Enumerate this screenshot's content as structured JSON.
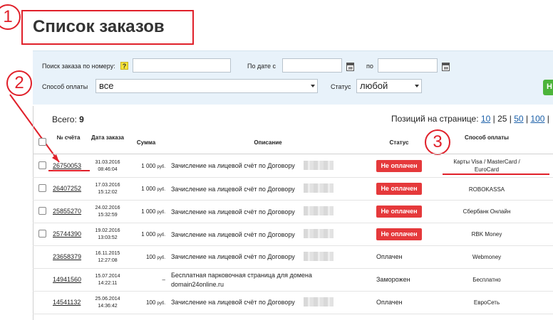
{
  "page": {
    "title": "Список заказов"
  },
  "callouts": {
    "one": "1",
    "two": "2",
    "three": "3"
  },
  "filters": {
    "search_label": "Поиск заказа по номеру:",
    "help": "?",
    "search_value": "",
    "date_from_label": "По дате с",
    "date_from_value": "",
    "date_to_label": "по",
    "date_to_value": "",
    "payment_label": "Способ оплаты",
    "payment_value": "все",
    "status_label": "Статус",
    "status_value": "любой",
    "apply_label": "Н"
  },
  "summary": {
    "total_label": "Всего:",
    "total_value": "9",
    "perpage_label": "Позиций на странице:",
    "opt10": "10",
    "opt25": "25",
    "opt50": "50",
    "opt100": "100",
    "sep": "|"
  },
  "columns": {
    "num": "№ счёта",
    "date": "Дата заказа",
    "sum": "Сумма",
    "desc": "Описание",
    "status": "Статус",
    "pay": "Способ оплаты"
  },
  "currency": "руб.",
  "rows": [
    {
      "num": "26750053",
      "date": "31.03.2016",
      "time": "08:46:04",
      "sum": "1 000",
      "desc": "Зачисление на лицевой счёт по Договору",
      "status": "Не оплачен",
      "pay": "Карты Visa / MasterCard / EuroCard"
    },
    {
      "num": "26407252",
      "date": "17.03.2016",
      "time": "15:12:02",
      "sum": "1 000",
      "desc": "Зачисление на лицевой счёт по Договору",
      "status": "Не оплачен",
      "pay": "ROBOKASSA"
    },
    {
      "num": "25855270",
      "date": "24.02.2016",
      "time": "15:32:59",
      "sum": "1 000",
      "desc": "Зачисление на лицевой счёт по Договору",
      "status": "Не оплачен",
      "pay": "Сбербанк Онлайн"
    },
    {
      "num": "25744390",
      "date": "19.02.2016",
      "time": "13:03:52",
      "sum": "1 000",
      "desc": "Зачисление на лицевой счёт по Договору",
      "status": "Не оплачен",
      "pay": "RBK Money"
    },
    {
      "num": "23658379",
      "date": "16.11.2015",
      "time": "12:27:08",
      "sum": "100",
      "desc": "Зачисление на лицевой счёт по Договору",
      "status": "Оплачен",
      "pay": "Webmoney"
    },
    {
      "num": "14941560",
      "date": "15.07.2014",
      "time": "14:22:11",
      "sum": "–",
      "desc": "Бесплатная парковочная страница для домена",
      "desc2": "domain24online.ru",
      "status": "Заморожен",
      "pay": "Бесплатно"
    },
    {
      "num": "14541132",
      "date": "25.06.2014",
      "time": "14:36:42",
      "sum": "100",
      "desc": "Зачисление на лицевой счёт по Договору",
      "status": "Оплачен",
      "pay": "ЕвроСеть"
    }
  ]
}
